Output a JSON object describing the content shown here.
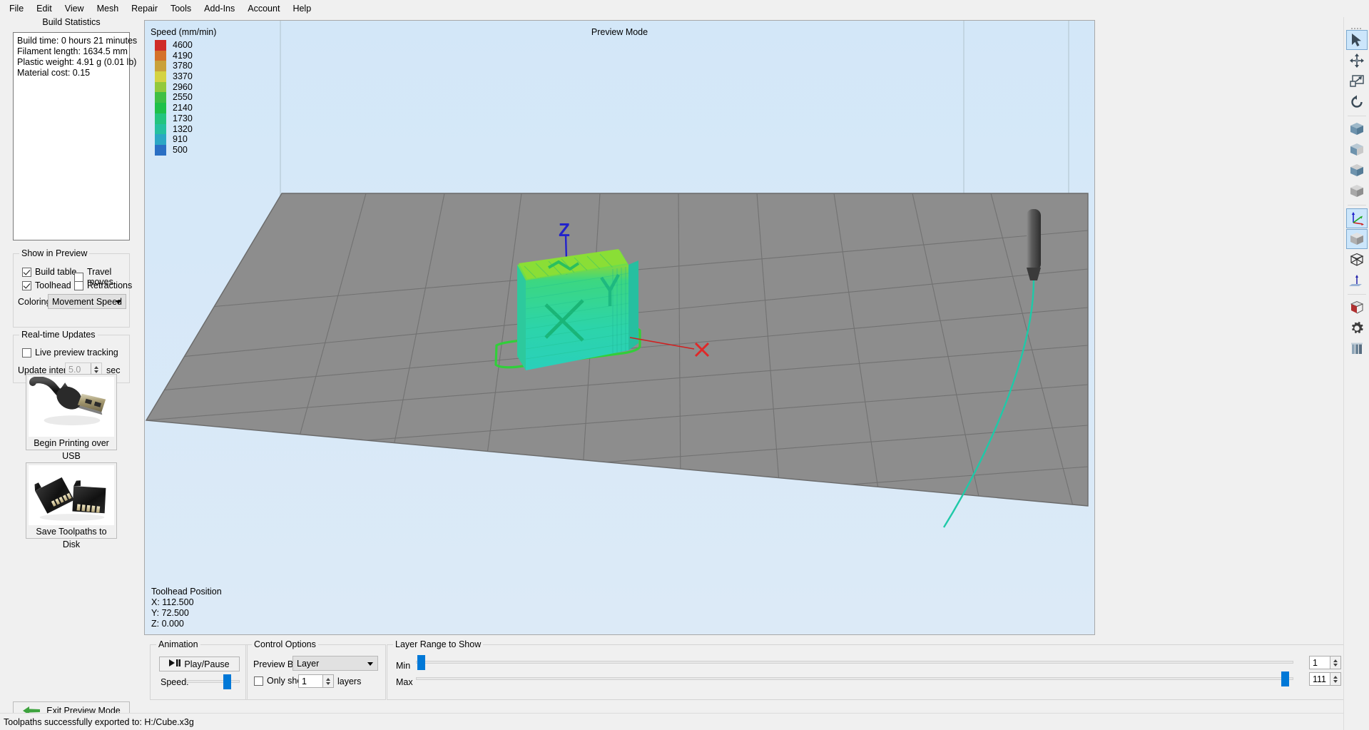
{
  "menubar": {
    "items": [
      {
        "label": "File"
      },
      {
        "label": "Edit"
      },
      {
        "label": "View"
      },
      {
        "label": "Mesh"
      },
      {
        "label": "Repair"
      },
      {
        "label": "Tools"
      },
      {
        "label": "Add-Ins"
      },
      {
        "label": "Account"
      },
      {
        "label": "Help"
      }
    ]
  },
  "left_panel": {
    "build_statistics": {
      "title": "Build Statistics",
      "lines": [
        "Build time: 0 hours 21 minutes",
        "Filament length: 1634.5 mm",
        "Plastic weight: 4.91 g (0.01 lb)",
        "Material cost: 0.15"
      ]
    },
    "show_in_preview": {
      "title": "Show in Preview",
      "checkboxes": [
        {
          "label": "Build table",
          "checked": true
        },
        {
          "label": "Travel moves",
          "checked": false
        },
        {
          "label": "Toolhead",
          "checked": true
        },
        {
          "label": "Retractions",
          "checked": false
        }
      ],
      "coloring_label": "Coloring",
      "coloring_value": "Movement Speed"
    },
    "realtime_updates": {
      "title": "Real-time Updates",
      "live_preview_label": "Live preview tracking",
      "live_preview_checked": false,
      "update_interval_label": "Update interval",
      "update_interval_value": "5.0",
      "update_interval_unit": "sec"
    },
    "buttons": {
      "usb_caption": "Begin Printing over USB",
      "sd_caption": "Save Toolpaths to Disk",
      "exit_label": "Exit Preview Mode"
    }
  },
  "viewport": {
    "preview_mode_label": "Preview Mode",
    "legend": {
      "title": "Speed (mm/min)",
      "entries": [
        {
          "value": "4600",
          "color": "#cf2b28"
        },
        {
          "value": "4190",
          "color": "#d4712a"
        },
        {
          "value": "3780",
          "color": "#c9a13a"
        },
        {
          "value": "3370",
          "color": "#d4d343"
        },
        {
          "value": "2960",
          "color": "#92c93d"
        },
        {
          "value": "2550",
          "color": "#3fbf45"
        },
        {
          "value": "2140",
          "color": "#1ec04a"
        },
        {
          "value": "1730",
          "color": "#23c47f"
        },
        {
          "value": "1320",
          "color": "#25c0a0"
        },
        {
          "value": "910",
          "color": "#2ba7c4"
        },
        {
          "value": "500",
          "color": "#2a6fc4"
        }
      ]
    },
    "toolhead_position": {
      "title": "Toolhead Position",
      "x": "X: 112.500",
      "y": "Y: 72.500",
      "z": "Z: 0.000"
    },
    "axis_labels": {
      "z": "Z",
      "x": "X",
      "y": "Y"
    }
  },
  "bottom": {
    "animation": {
      "title": "Animation",
      "play_pause_label": "Play/Pause",
      "speed_label": "Speed:"
    },
    "control_options": {
      "title": "Control Options",
      "preview_by_label": "Preview By",
      "preview_by_value": "Layer",
      "only_show_label": "Only show",
      "only_show_checked": false,
      "only_show_value": "1",
      "layers_label": "layers"
    },
    "layer_range": {
      "title": "Layer Range to Show",
      "min_label": "Min",
      "max_label": "Max",
      "min_value": "1",
      "max_value": "111"
    }
  },
  "right_toolbar": {
    "tools": [
      {
        "name": "select-arrow-tool",
        "active": true
      },
      {
        "name": "move-tool",
        "active": false
      },
      {
        "name": "scale-tool",
        "active": false
      },
      {
        "name": "rotate-tool",
        "active": false
      },
      {
        "name": "view-solid-tool",
        "active": false
      },
      {
        "name": "view-half-tool",
        "active": false
      },
      {
        "name": "view-shaded-tool",
        "active": false
      },
      {
        "name": "view-gray-tool",
        "active": false
      },
      {
        "name": "axes-view-tool",
        "active": true
      },
      {
        "name": "cube-view-tool",
        "active": true
      },
      {
        "name": "wireframe-tool",
        "active": false
      },
      {
        "name": "normals-tool",
        "active": false
      },
      {
        "name": "cross-section-tool",
        "active": false
      },
      {
        "name": "settings-gear-tool",
        "active": false
      },
      {
        "name": "columns-tool",
        "active": false
      }
    ]
  },
  "statusbar": {
    "message": "Toolpaths successfully exported to: H:/Cube.x3g"
  },
  "colors": {
    "accent": "#0078d7",
    "panel_bg": "#f0f0f0",
    "viewport_bg": "#d8eaf8",
    "build_plate": "#8a8a8a",
    "model_green": "#2ddba0"
  }
}
